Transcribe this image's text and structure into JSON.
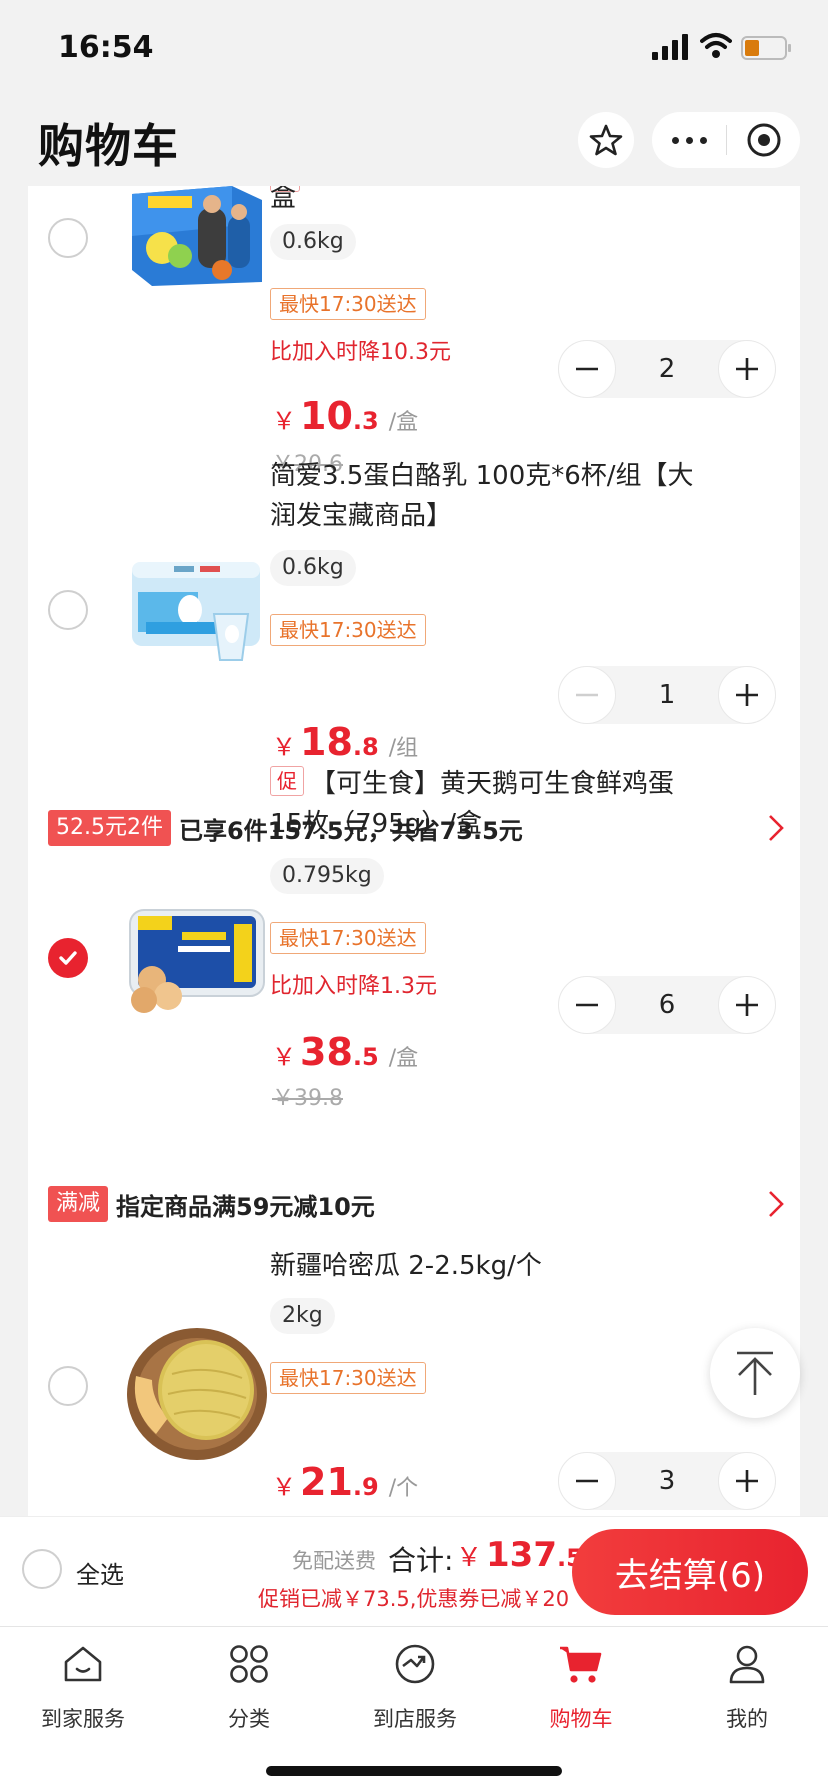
{
  "status_bar": {
    "time": "16:54"
  },
  "header": {
    "title": "购物车"
  },
  "items": [
    {
      "name_tail": "盒",
      "spec": "0.6kg",
      "delivery": "最快17:30送达",
      "price_drop": "比加入时降10.3元",
      "price_int": "10",
      "price_dec": ".3",
      "unit": "/盒",
      "original_price": "￥20.6",
      "quantity": "2",
      "checked": false
    },
    {
      "name": "简爱3.5蛋白酪乳 100克*6杯/组【大润发宝藏商品】",
      "spec": "0.6kg",
      "delivery": "最快17:30送达",
      "price_int": "18",
      "price_dec": ".8",
      "unit": "/组",
      "quantity": "1",
      "checked": false
    },
    {
      "tag": "促",
      "name": "【可生食】黄天鹅可生食鲜鸡蛋15枚（795g）/盒",
      "spec": "0.795kg",
      "delivery": "最快17:30送达",
      "price_drop": "比加入时降1.3元",
      "price_int": "38",
      "price_dec": ".5",
      "unit": "/盒",
      "original_price": "￥39.8",
      "quantity": "6",
      "checked": true
    },
    {
      "name": "新疆哈密瓜 2-2.5kg/个",
      "spec": "2kg",
      "delivery": "最快17:30送达",
      "price_int": "21",
      "price_dec": ".9",
      "unit": "/个",
      "quantity": "3",
      "checked": false
    }
  ],
  "promos": [
    {
      "tag": "52.5元2件",
      "text": "已享6件157.5元，共省73.5元"
    },
    {
      "tag": "满减",
      "text": "指定商品满59元减10元"
    }
  ],
  "currency": "￥",
  "checkout": {
    "select_all": "全选",
    "free_shipping": "免配送费",
    "total_label": "合计:",
    "total_int": "137",
    "total_dec": ".5",
    "promo_summary": "促销已减￥73.5,优惠券已减￥20",
    "pay_button": "去结算(6)"
  },
  "tabs": [
    {
      "label": "到家服务",
      "icon": "home-icon"
    },
    {
      "label": "分类",
      "icon": "category-icon"
    },
    {
      "label": "到店服务",
      "icon": "store-service-icon"
    },
    {
      "label": "购物车",
      "icon": "cart-icon",
      "active": true
    },
    {
      "label": "我的",
      "icon": "profile-icon"
    }
  ],
  "colors": {
    "accent": "#e8232f",
    "delivery": "#e8732b",
    "background": "#f2f2f2"
  }
}
